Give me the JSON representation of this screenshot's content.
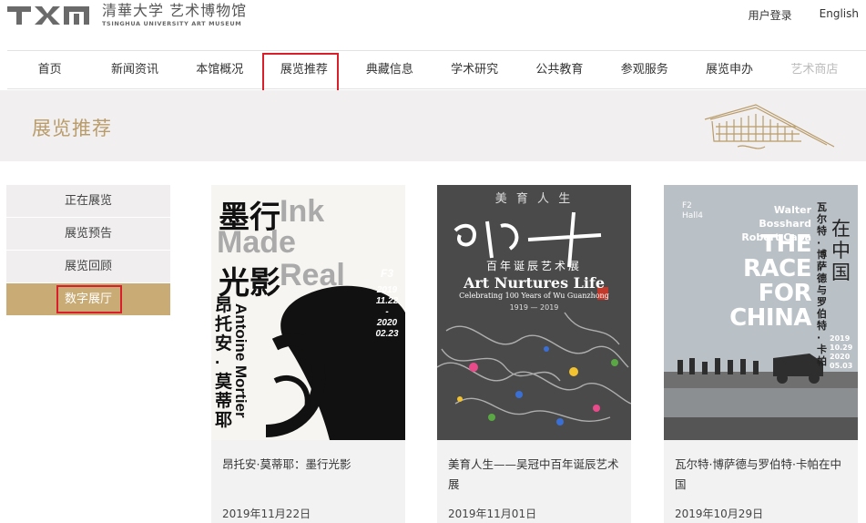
{
  "header": {
    "logo_cn": "清華大学 艺术博物馆",
    "logo_en": "TSINGHUA UNIVERSITY ART MUSEUM",
    "login": "用户登录",
    "language": "English"
  },
  "nav": {
    "items": [
      {
        "label": "首页"
      },
      {
        "label": "新闻资讯"
      },
      {
        "label": "本馆概况"
      },
      {
        "label": "展览推荐"
      },
      {
        "label": "典藏信息"
      },
      {
        "label": "学术研究"
      },
      {
        "label": "公共教育"
      },
      {
        "label": "参观服务"
      },
      {
        "label": "展览申办"
      },
      {
        "label": "艺术商店"
      }
    ],
    "active_index": 3
  },
  "banner": {
    "title": "展览推荐"
  },
  "sidebar": {
    "items": [
      {
        "label": "正在展览"
      },
      {
        "label": "展览预告"
      },
      {
        "label": "展览回顾"
      },
      {
        "label": "数字展厅"
      }
    ],
    "active_index": 3
  },
  "cards": [
    {
      "title": "昂托安·莫蒂耶：墨行光影",
      "date": "2019年11月22日",
      "poster": {
        "cn_line1": "墨行",
        "cn_line2": "光影",
        "en_1": "Ink",
        "en_2": "Made",
        "en_3": "Real",
        "floor": "F3",
        "d1": "2019",
        "d2": "11.22",
        "d3": "-",
        "d4": "2020",
        "d5": "02.23",
        "artist_cn": "昂托安·莫蒂耶",
        "artist_en": "Antoine Mortier"
      }
    },
    {
      "title": "美育人生——吴冠中百年诞辰艺术展",
      "date": "2019年11月01日",
      "poster": {
        "top": "美 育 人 生",
        "sub_cn": "百年诞辰艺术展",
        "en_title": "Art Nurtures Life",
        "en_sub": "Celebrating 100 Years of Wu Guanzhong",
        "years": "1919 — 2019"
      }
    },
    {
      "title": "瓦尔特·博萨德与罗伯特·卡帕在中国",
      "date": "2019年10月29日",
      "poster": {
        "floor": "F2",
        "hall": "Hall4",
        "names_en_1": "Walter Bosshard",
        "names_en_2": "Robert Capa",
        "race_1": "THE",
        "race_2": "RACE",
        "race_3": "FOR",
        "race_4": "CHINA",
        "cn_vert": "瓦尔特·博萨德与罗伯特·卡帕",
        "cn_big": "在中国",
        "d1": "2019",
        "d2": "10.29",
        "d3": "2020",
        "d4": "05.03"
      }
    }
  ]
}
